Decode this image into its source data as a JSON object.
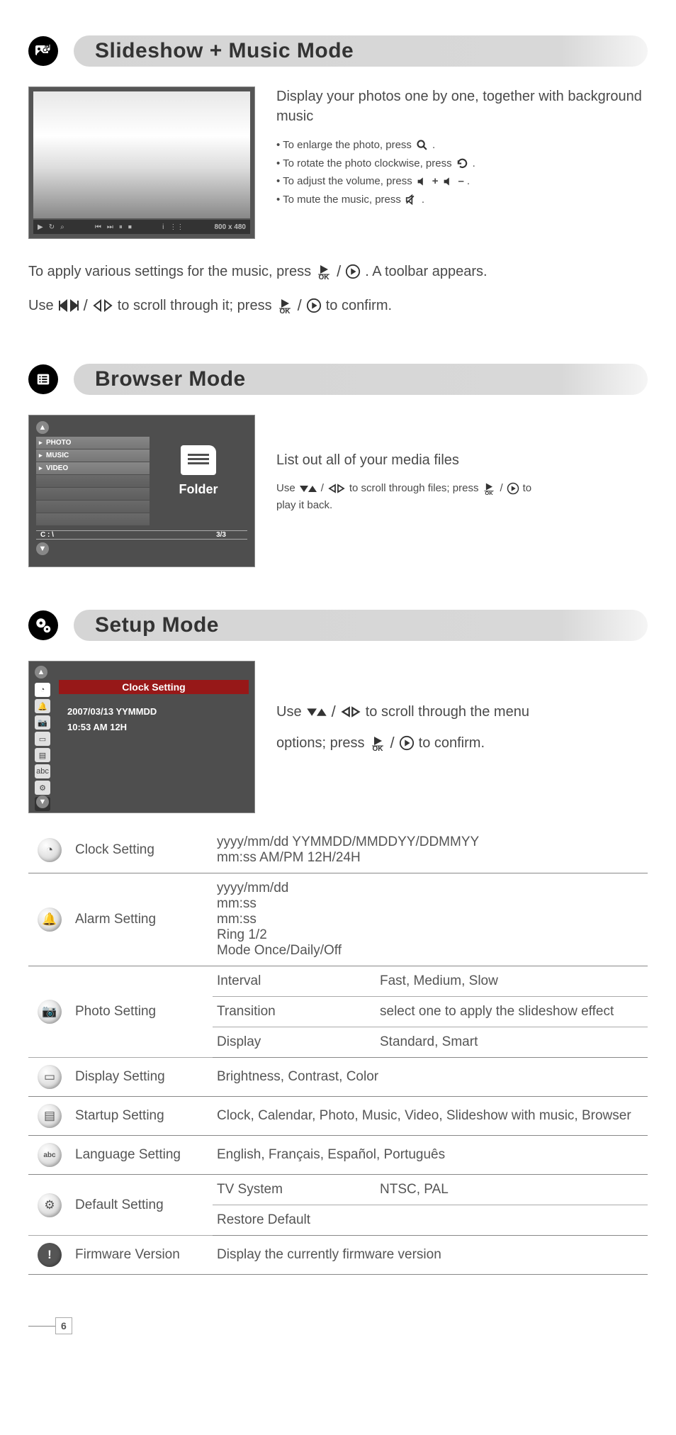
{
  "sections": {
    "slideshow": {
      "title": "Slideshow + Music Mode",
      "desc": "Display your photos one by one, together with background music",
      "bullets": {
        "b1a": "• To enlarge the photo, press ",
        "b1b": ".",
        "b2a": "• To rotate the photo clockwise, press ",
        "b2b": ".",
        "b3a": "• To adjust the volume, press ",
        "b3b": ".",
        "b4a": "• To mute the music, press ",
        "b4b": "."
      },
      "photo_res": "800 x 480",
      "p1a": "To apply various settings for the music, press",
      "p1b": ". A toolbar appears.",
      "p2a": "Use",
      "p2b": "to scroll through it; press",
      "p2c": "to confirm."
    },
    "browser": {
      "title": "Browser Mode",
      "desc": "List out all of your media files",
      "t1a": "Use",
      "t1b": "to scroll through files; press",
      "t1c": "to",
      "t1d": "play it back.",
      "items": {
        "photo": "PHOTO",
        "music": "MUSIC",
        "video": "VIDEO"
      },
      "folder_label": "Folder",
      "path": "C : \\",
      "count": "3/3"
    },
    "setup": {
      "title": "Setup Mode",
      "clock_header": "Clock Setting",
      "date_line": "2007/03/13 YYMMDD",
      "time_line": "10:53  AM   12H",
      "p1a": "Use",
      "p1b": "to scroll through the menu",
      "p1c": "options; press",
      "p1d": "to confirm."
    }
  },
  "table": {
    "clock": {
      "label": "Clock Setting",
      "v1": "yyyy/mm/dd    YYMMDD/MMDDYY/DDMMYY",
      "v2": "mm:ss   AM/PM  12H/24H"
    },
    "alarm": {
      "label": "Alarm Setting",
      "v1": "yyyy/mm/dd",
      "v2": "mm:ss",
      "v3": "Ring     1/2",
      "v4": "Mode     Once/Daily/Off"
    },
    "photo": {
      "label": "Photo Setting",
      "r1a": "Interval",
      "r1b": "Fast, Medium, Slow",
      "r2a": "Transition",
      "r2b": "select one to apply the slideshow effect",
      "r3a": "Display",
      "r3b": "Standard, Smart"
    },
    "display": {
      "label": "Display Setting",
      "v": "Brightness, Contrast, Color"
    },
    "startup": {
      "label": "Startup Setting",
      "v": "Clock, Calendar, Photo, Music, Video, Slideshow with music, Browser"
    },
    "language": {
      "label": "Language Setting",
      "v": "English, Français, Español, Português"
    },
    "default": {
      "label": "Default Setting",
      "r1a": "TV System",
      "r1b": "NTSC, PAL",
      "r2": "Restore Default"
    },
    "firmware": {
      "label": "Firmware Version",
      "v": "Display the currently firmware version"
    }
  },
  "page_number": "6"
}
